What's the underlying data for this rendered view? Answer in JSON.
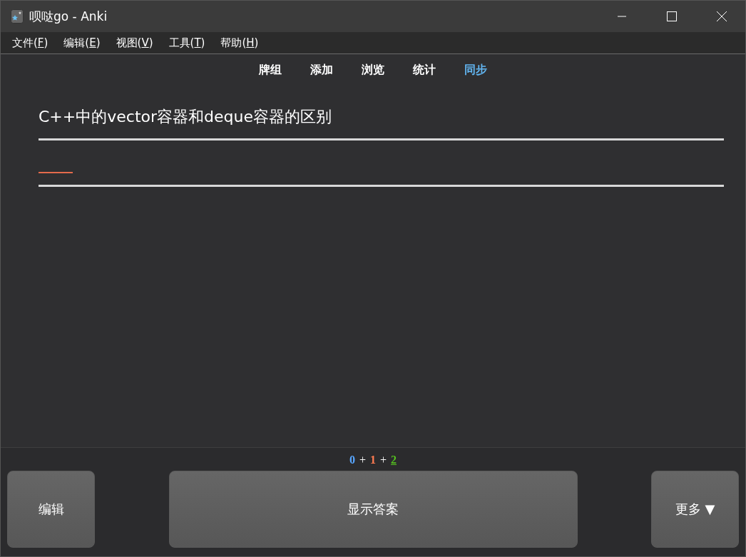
{
  "window": {
    "title": "呗哒go - Anki"
  },
  "menu": [
    {
      "label": "文件(",
      "key": "F",
      "end": ")"
    },
    {
      "label": "编辑(",
      "key": "E",
      "end": ")"
    },
    {
      "label": "视图(",
      "key": "V",
      "end": ")"
    },
    {
      "label": "工具(",
      "key": "T",
      "end": ")"
    },
    {
      "label": "帮助(",
      "key": "H",
      "end": ")"
    }
  ],
  "nav": [
    {
      "label": "牌组",
      "highlighted": false
    },
    {
      "label": "添加",
      "highlighted": false
    },
    {
      "label": "浏览",
      "highlighted": false
    },
    {
      "label": "统计",
      "highlighted": false
    },
    {
      "label": "同步",
      "highlighted": true
    }
  ],
  "card": {
    "question": "C++中的vector容器和deque容器的区别"
  },
  "counts": [
    {
      "value": "0",
      "color": "#58a6ff",
      "selected": false
    },
    {
      "value": "1",
      "color": "#ff7b51",
      "selected": false
    },
    {
      "value": "2",
      "color": "#55c11f",
      "selected": true
    }
  ],
  "count_separator": "+",
  "buttons": {
    "edit": "编辑",
    "show_answer": "显示答案",
    "more": "更多 ▼"
  }
}
